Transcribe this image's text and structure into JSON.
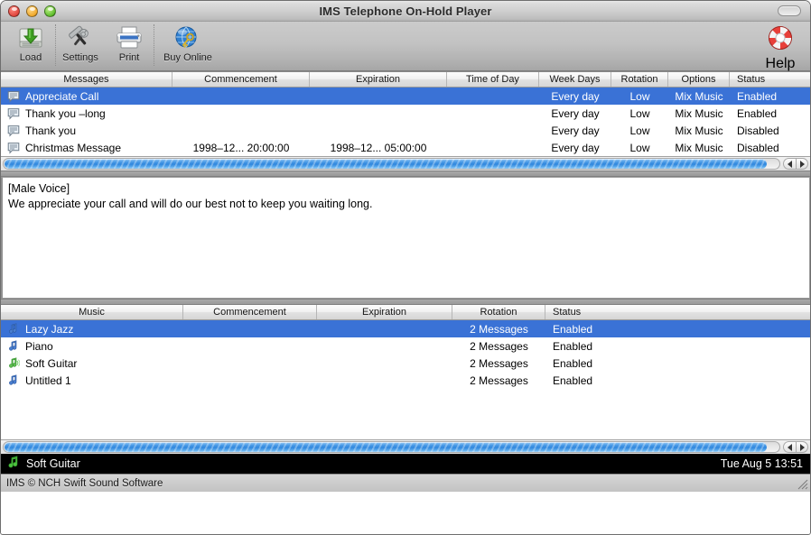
{
  "window": {
    "title": "IMS Telephone On-Hold Player",
    "controls": {
      "close": "close",
      "minimize": "minimize",
      "zoom": "zoom"
    },
    "toolbar_toggle": "toolbar-toggle"
  },
  "toolbar": {
    "items": [
      {
        "label": "Load",
        "icon": "load-disk-icon"
      },
      {
        "label": "Settings",
        "icon": "hammer-wrench-icon"
      },
      {
        "label": "Print",
        "icon": "printer-icon"
      },
      {
        "label": "Buy Online",
        "icon": "globe-key-icon"
      }
    ],
    "help": {
      "label": "Help",
      "icon": "life-ring-icon"
    }
  },
  "messages_table": {
    "columns": [
      "Messages",
      "Commencement",
      "Expiration",
      "Time of Day",
      "Week Days",
      "Rotation",
      "Options",
      "Status"
    ],
    "rows": [
      {
        "icon": "message-document-icon",
        "name": "Appreciate Call",
        "commencement": "",
        "expiration": "",
        "time_of_day": "",
        "week_days": "Every day",
        "rotation": "Low",
        "options": "Mix Music",
        "status": "Enabled",
        "selected": true
      },
      {
        "icon": "message-document-icon",
        "name": "Thank you –long",
        "commencement": "",
        "expiration": "",
        "time_of_day": "",
        "week_days": "Every day",
        "rotation": "Low",
        "options": "Mix Music",
        "status": "Enabled",
        "selected": false
      },
      {
        "icon": "message-document-icon",
        "name": "Thank you",
        "commencement": "",
        "expiration": "",
        "time_of_day": "",
        "week_days": "Every day",
        "rotation": "Low",
        "options": "Mix Music",
        "status": "Disabled",
        "selected": false
      },
      {
        "icon": "message-document-icon",
        "name": "Christmas Message",
        "commencement": "1998–12... 20:00:00",
        "expiration": "1998–12... 05:00:00",
        "time_of_day": "",
        "week_days": "Every day",
        "rotation": "Low",
        "options": "Mix Music",
        "status": "Disabled",
        "selected": false
      }
    ]
  },
  "script_panel": {
    "line1": "[Male Voice]",
    "line2": "We appreciate your call and will do our best not to keep you waiting long."
  },
  "music_table": {
    "columns": [
      "Music",
      "Commencement",
      "Expiration",
      "Rotation",
      "Status"
    ],
    "rows": [
      {
        "icon": "music-note-icon",
        "name": "Lazy Jazz",
        "commencement": "",
        "expiration": "",
        "rotation": "2 Messages",
        "status": "Enabled",
        "selected": true,
        "playing": false
      },
      {
        "icon": "music-note-icon",
        "name": "Piano",
        "commencement": "",
        "expiration": "",
        "rotation": "2 Messages",
        "status": "Enabled",
        "selected": false,
        "playing": false
      },
      {
        "icon": "music-note-playing-icon",
        "name": "Soft Guitar",
        "commencement": "",
        "expiration": "",
        "rotation": "2 Messages",
        "status": "Enabled",
        "selected": false,
        "playing": true
      },
      {
        "icon": "music-note-icon",
        "name": "Untitled 1",
        "commencement": "",
        "expiration": "",
        "rotation": "2 Messages",
        "status": "Enabled",
        "selected": false,
        "playing": false
      }
    ]
  },
  "player_bar": {
    "icon": "now-playing-note-icon",
    "now_playing": "Soft Guitar",
    "clock": "Tue Aug  5 13:51"
  },
  "status_bar": {
    "text": "IMS © NCH Swift Sound Software",
    "resize_grip": "resize-grip"
  },
  "colors": {
    "selection_blue": "#3a72d6",
    "scrollbar_blue": "#2f86dd",
    "playbar_bg": "#000000",
    "playing_green": "#4caf50"
  }
}
